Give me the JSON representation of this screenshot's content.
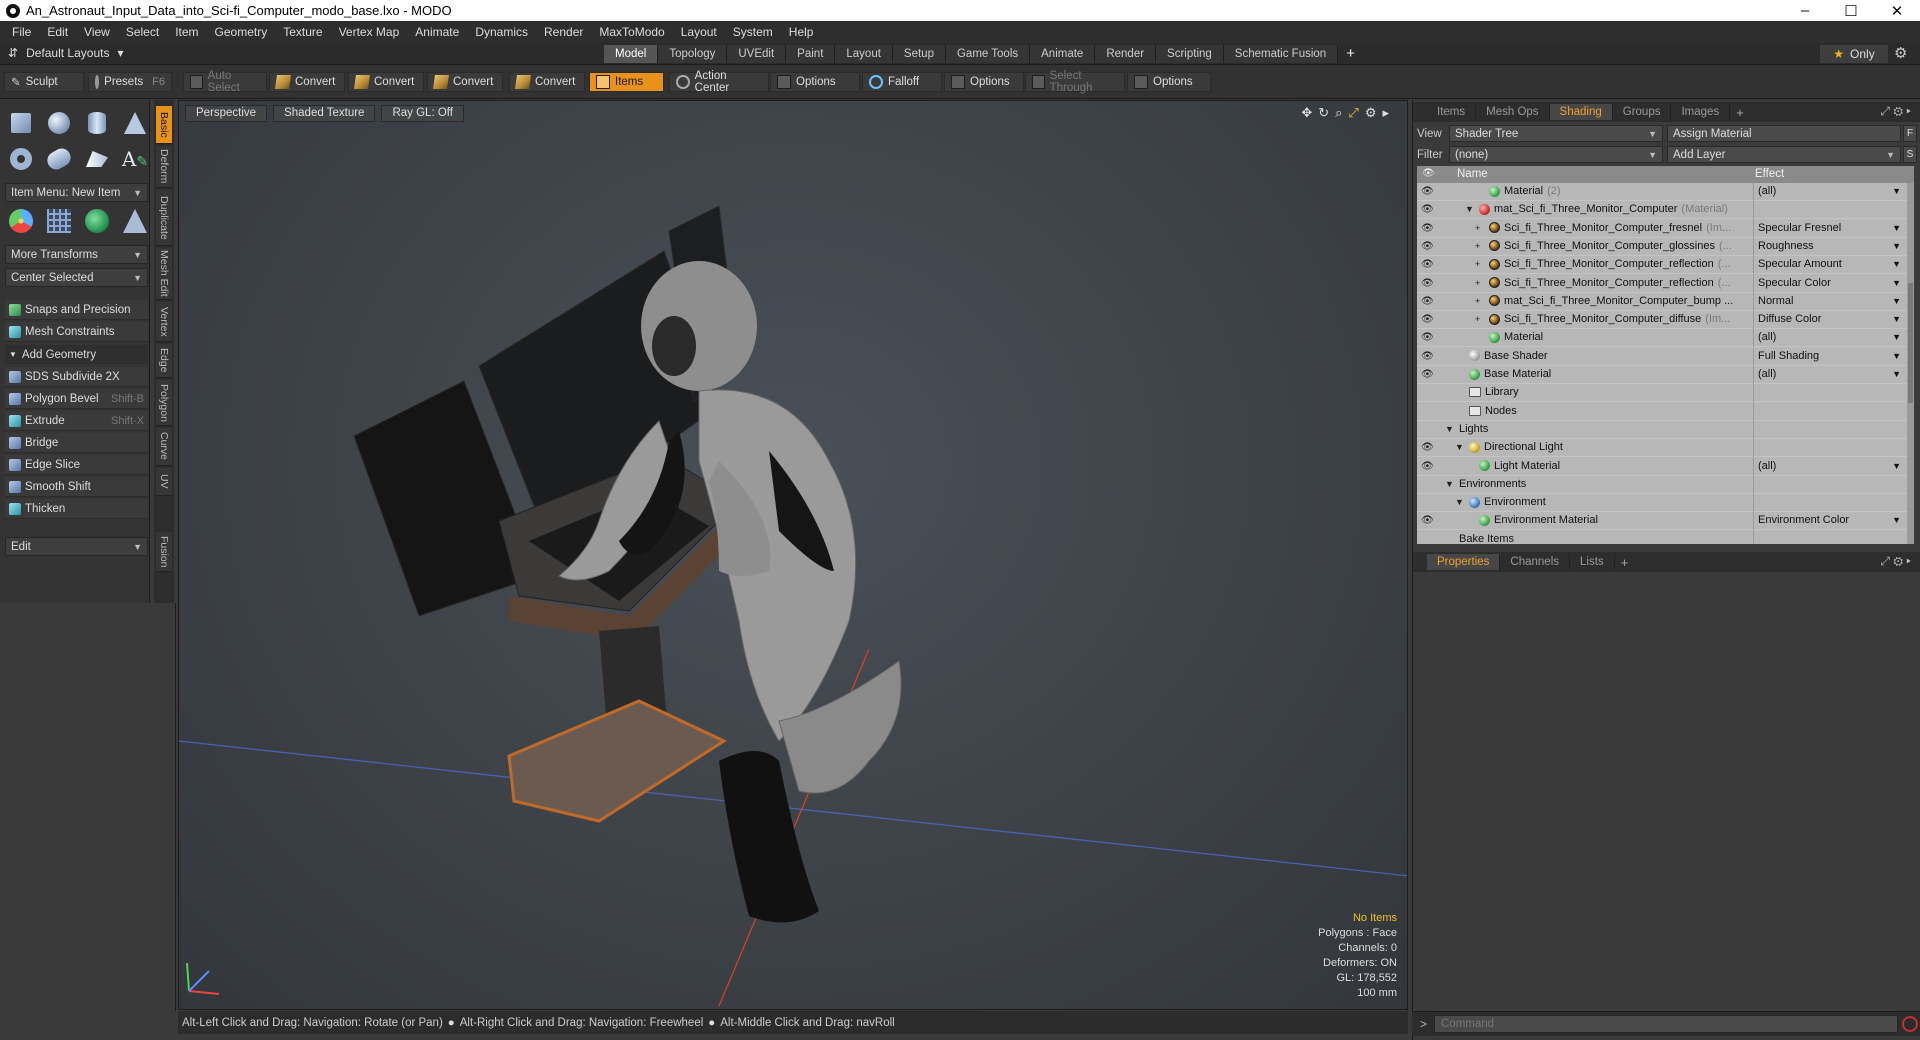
{
  "window": {
    "title": "An_Astronaut_Input_Data_into_Sci-fi_Computer_modo_base.lxo - MODO",
    "controls": [
      "–",
      "☐",
      "✕"
    ]
  },
  "menubar": [
    "File",
    "Edit",
    "View",
    "Select",
    "Item",
    "Geometry",
    "Texture",
    "Vertex Map",
    "Animate",
    "Dynamics",
    "Render",
    "MaxToModo",
    "Layout",
    "System",
    "Help"
  ],
  "layout": {
    "selector": "Default Layouts",
    "tabs": [
      "Model",
      "Topology",
      "UVEdit",
      "Paint",
      "Layout",
      "Setup",
      "Game Tools",
      "Animate",
      "Render",
      "Scripting",
      "Schematic Fusion"
    ],
    "active_tab": "Model",
    "only_label": "Only"
  },
  "toolbar": {
    "sculpt": "Sculpt",
    "presets": "Presets",
    "presets_key": "F6",
    "auto_select": "Auto Select",
    "convert1": "Convert",
    "convert2": "Convert",
    "convert3": "Convert",
    "convert4": "Convert",
    "items": "Items",
    "action_center": "Action Center",
    "options1": "Options",
    "falloff": "Falloff",
    "options2": "Options",
    "select_through": "Select Through",
    "options3": "Options"
  },
  "leftpanel": {
    "item_menu": "Item Menu: New Item",
    "more_transforms": "More Transforms",
    "center_selected": "Center Selected",
    "snaps": "Snaps and Precision",
    "mesh_constraints": "Mesh Constraints",
    "add_geometry": "Add Geometry",
    "tools": [
      {
        "label": "SDS Subdivide 2X",
        "key": ""
      },
      {
        "label": "Polygon Bevel",
        "key": "Shift-B"
      },
      {
        "label": "Extrude",
        "key": "Shift-X"
      },
      {
        "label": "Bridge",
        "key": ""
      },
      {
        "label": "Edge Slice",
        "key": ""
      },
      {
        "label": "Smooth Shift",
        "key": ""
      },
      {
        "label": "Thicken",
        "key": ""
      }
    ],
    "edit": "Edit",
    "vtabs": [
      "Basic",
      "Deform",
      "Duplicate",
      "Mesh Edit",
      "Vertex",
      "Edge",
      "Polygon",
      "Curve",
      "UV",
      "Fusion"
    ]
  },
  "viewport": {
    "perspective": "Perspective",
    "shading": "Shaded Texture",
    "raygl": "Ray GL: Off",
    "info": {
      "items": "No Items",
      "polygons": "Polygons : Face",
      "channels": "Channels: 0",
      "deformers": "Deformers: ON",
      "gl": "GL: 178,552",
      "scale": "100 mm"
    }
  },
  "statusbar": {
    "hint1": "Alt-Left Click and Drag: Navigation: Rotate (or Pan)",
    "hint2": "Alt-Right Click and Drag: Navigation: Freewheel",
    "hint3": "Alt-Middle Click and Drag: navRoll"
  },
  "rightpanel": {
    "tabs": [
      "Items",
      "Mesh Ops",
      "Shading",
      "Groups",
      "Images"
    ],
    "active_tab": "Shading",
    "view_label": "View",
    "view_value": "Shader Tree",
    "assign_material": "Assign Material",
    "filter_label": "Filter",
    "filter_value": "(none)",
    "add_layer": "Add Layer",
    "tree_header": {
      "name": "Name",
      "effect": "Effect"
    },
    "tree": [
      {
        "indent": 4,
        "exp": "",
        "icon": "green",
        "name": "Material",
        "sub": "(2)",
        "effect": "(all)",
        "eye": true
      },
      {
        "indent": 3,
        "exp": "▼",
        "icon": "red",
        "name": "mat_Sci_fi_Three_Monitor_Computer",
        "sub": "(Material)",
        "effect": "",
        "eye": true
      },
      {
        "indent": 4,
        "exp": "+",
        "icon": "tex",
        "name": "Sci_fi_Three_Monitor_Computer_fresnel",
        "sub": "(Im...",
        "effect": "Specular Fresnel",
        "eye": true
      },
      {
        "indent": 4,
        "exp": "+",
        "icon": "tex",
        "name": "Sci_fi_Three_Monitor_Computer_glossines",
        "sub": "(...",
        "effect": "Roughness",
        "eye": true
      },
      {
        "indent": 4,
        "exp": "+",
        "icon": "tex",
        "name": "Sci_fi_Three_Monitor_Computer_reflection",
        "sub": "(...",
        "effect": "Specular Amount",
        "eye": true
      },
      {
        "indent": 4,
        "exp": "+",
        "icon": "tex",
        "name": "Sci_fi_Three_Monitor_Computer_reflection",
        "sub": "(...",
        "effect": "Specular Color",
        "eye": true
      },
      {
        "indent": 4,
        "exp": "+",
        "icon": "tex",
        "name": "mat_Sci_fi_Three_Monitor_Computer_bump ...",
        "sub": "",
        "effect": "Normal",
        "eye": true
      },
      {
        "indent": 4,
        "exp": "+",
        "icon": "tex",
        "name": "Sci_fi_Three_Monitor_Computer_diffuse",
        "sub": "(Im...",
        "effect": "Diffuse Color",
        "eye": true
      },
      {
        "indent": 4,
        "exp": "",
        "icon": "green",
        "name": "Material",
        "sub": "",
        "effect": "(all)",
        "eye": true
      },
      {
        "indent": 2,
        "exp": "",
        "icon": "grey",
        "name": "Base Shader",
        "sub": "",
        "effect": "Full Shading",
        "eye": true
      },
      {
        "indent": 2,
        "exp": "",
        "icon": "green",
        "name": "Base Material",
        "sub": "",
        "effect": "(all)",
        "eye": true
      },
      {
        "indent": 2,
        "exp": "",
        "icon": "folder",
        "name": "Library",
        "sub": "",
        "effect": "",
        "eye": false
      },
      {
        "indent": 2,
        "exp": "",
        "icon": "folder",
        "name": "Nodes",
        "sub": "",
        "effect": "",
        "eye": false
      },
      {
        "indent": 1,
        "exp": "▼",
        "icon": "none",
        "name": "Lights",
        "sub": "",
        "effect": "",
        "eye": false
      },
      {
        "indent": 2,
        "exp": "▼",
        "icon": "light",
        "name": "Directional Light",
        "sub": "",
        "effect": "",
        "eye": true
      },
      {
        "indent": 3,
        "exp": "",
        "icon": "green",
        "name": "Light Material",
        "sub": "",
        "effect": "(all)",
        "eye": true
      },
      {
        "indent": 1,
        "exp": "▼",
        "icon": "none",
        "name": "Environments",
        "sub": "",
        "effect": "",
        "eye": false
      },
      {
        "indent": 2,
        "exp": "▼",
        "icon": "env",
        "name": "Environment",
        "sub": "",
        "effect": "",
        "eye": false
      },
      {
        "indent": 3,
        "exp": "",
        "icon": "green",
        "name": "Environment Material",
        "sub": "",
        "effect": "Environment Color",
        "eye": true
      },
      {
        "indent": 1,
        "exp": "",
        "icon": "none",
        "name": "Bake Items",
        "sub": "",
        "effect": "",
        "eye": false
      }
    ],
    "prop_tabs": [
      "Properties",
      "Channels",
      "Lists"
    ],
    "active_prop_tab": "Properties",
    "command_placeholder": "Command"
  }
}
